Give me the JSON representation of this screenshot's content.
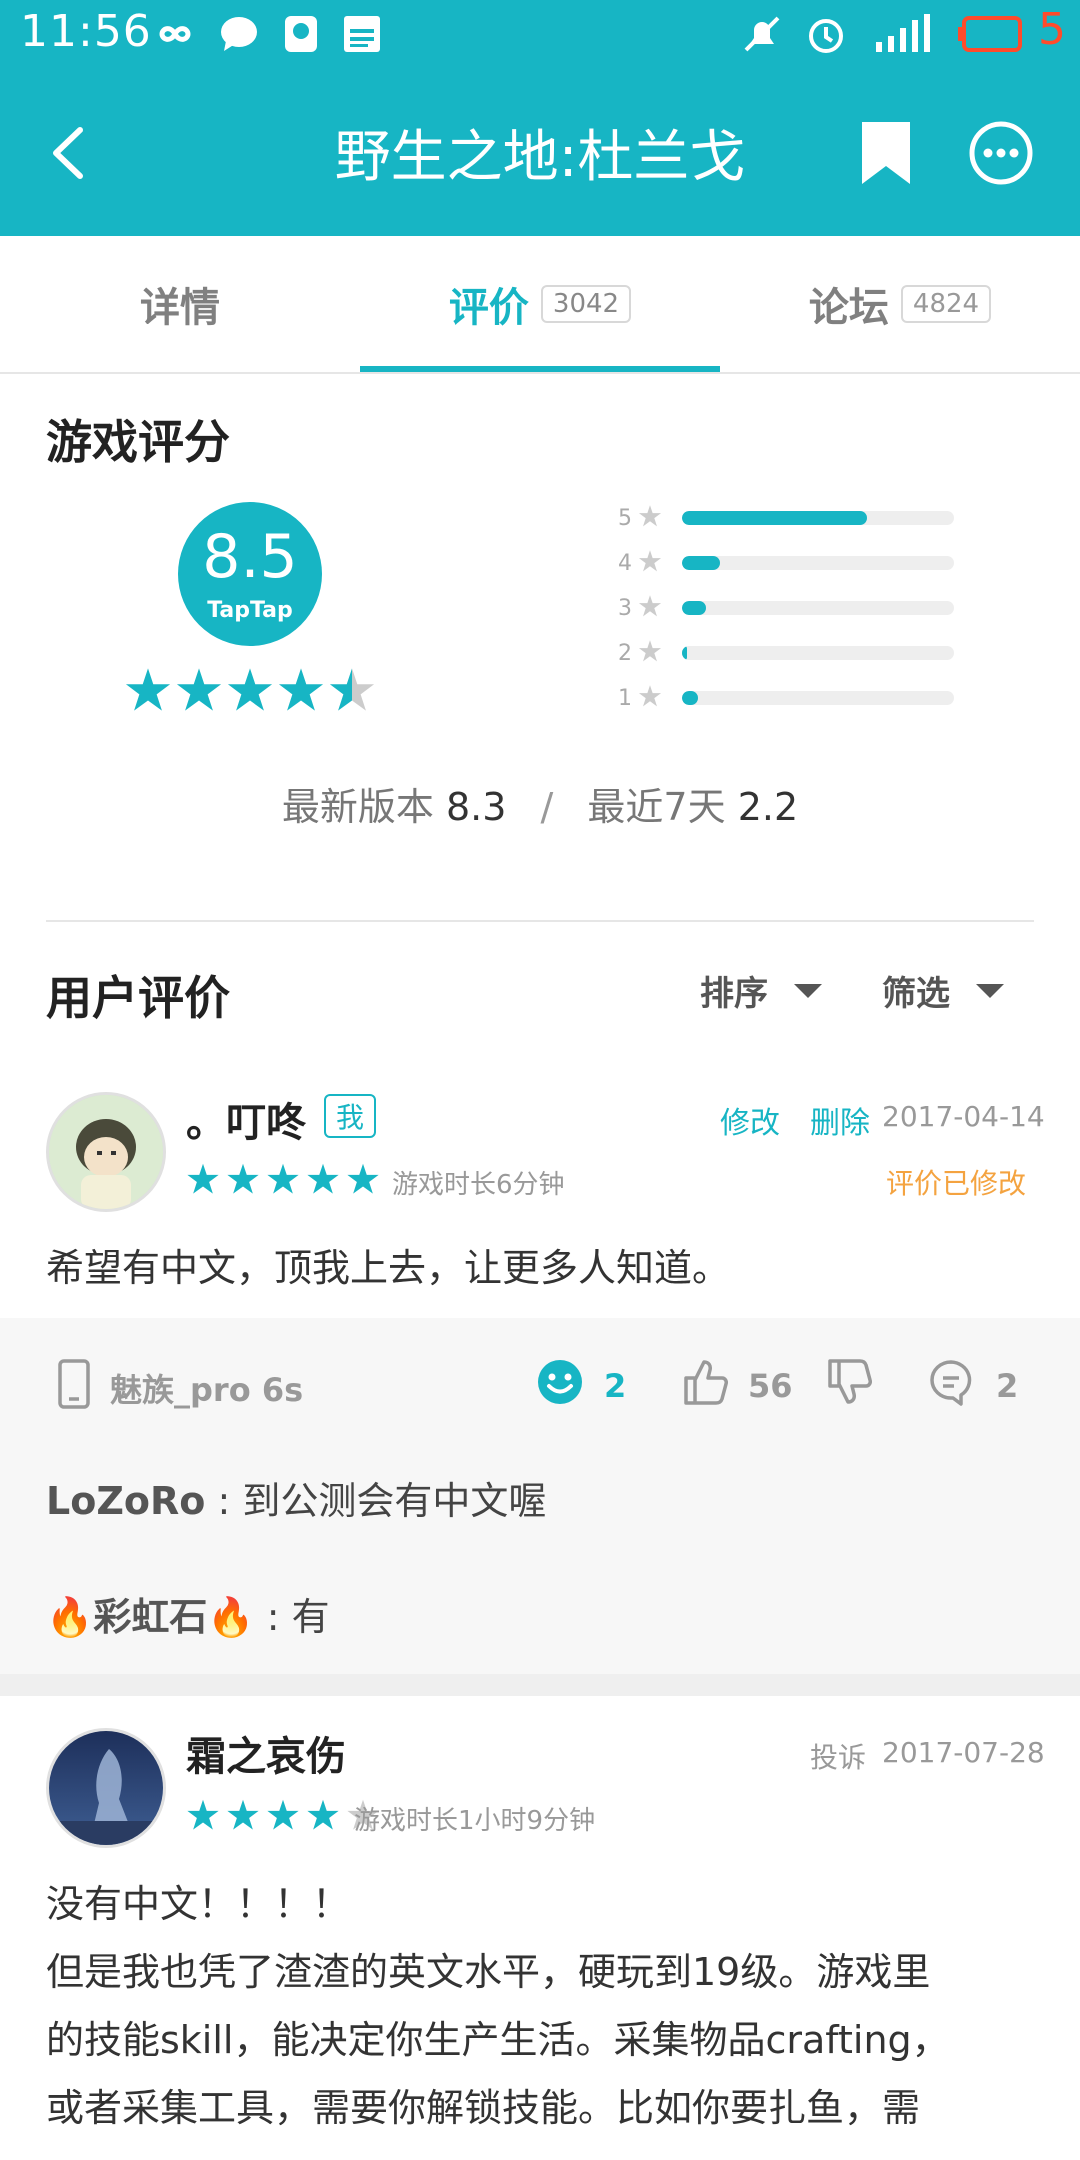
{
  "status_bar": {
    "time": "11:56",
    "battery": "5"
  },
  "header": {
    "title": "野生之地:杜兰戈"
  },
  "tabs": [
    {
      "label": "详情"
    },
    {
      "label": "评价",
      "count": "3042"
    },
    {
      "label": "论坛",
      "count": "4824"
    }
  ],
  "rating": {
    "section_title": "游戏评分",
    "score": "8.5",
    "brand": "TapTap",
    "stars": 4.5,
    "distribution": [
      {
        "label": "5",
        "fraction": 0.68
      },
      {
        "label": "4",
        "fraction": 0.14
      },
      {
        "label": "3",
        "fraction": 0.09
      },
      {
        "label": "2",
        "fraction": 0.02
      },
      {
        "label": "1",
        "fraction": 0.06
      }
    ],
    "latest_version_label": "最新版本",
    "latest_version_score": "8.3",
    "separator": "/",
    "recent_label": "最近7天",
    "recent_score": "2.2"
  },
  "user_reviews": {
    "title": "用户评价",
    "sort_label": "排序",
    "filter_label": "筛选"
  },
  "reviews": [
    {
      "username": "。叮咚",
      "me_badge": "我",
      "edit_label": "修改",
      "delete_label": "删除",
      "date": "2017-04-14",
      "stars": 5,
      "playtime": "游戏时长6分钟",
      "modified_note": "评价已修改",
      "text": "希望有中文，顶我上去，让更多人知道。",
      "device": "魅族_pro 6s",
      "funny_count": "2",
      "like_count": "56",
      "comment_count": "2",
      "replies": [
        {
          "user": "LoZoRo",
          "text": " : 到公测会有中文喔"
        },
        {
          "user": "🔥彩虹石🔥",
          "text": " : 有"
        }
      ]
    },
    {
      "username": "霜之哀伤",
      "report_label": "投诉",
      "date": "2017-07-28",
      "stars": 4,
      "playtime": "游戏时长1小时9分钟",
      "text_lines": [
        "没有中文！！！！",
        "但是我也凭了渣渣的英文水平，硬玩到19级。游戏里",
        "的技能skill，能决定你生产生活。采集物品crafting，",
        "或者采集工具，需要你解锁技能。比如你要扎鱼，需"
      ]
    }
  ],
  "colors": {
    "accent": "#17b5c4",
    "modified": "#f4a340",
    "battery_low": "#ff4b2b"
  },
  "icons": [
    "back-arrow-icon",
    "bookmark-icon",
    "more-icon",
    "phone-icon",
    "smile-icon",
    "thumb-up-icon",
    "thumb-down-icon",
    "comment-icon",
    "star-icon"
  ]
}
